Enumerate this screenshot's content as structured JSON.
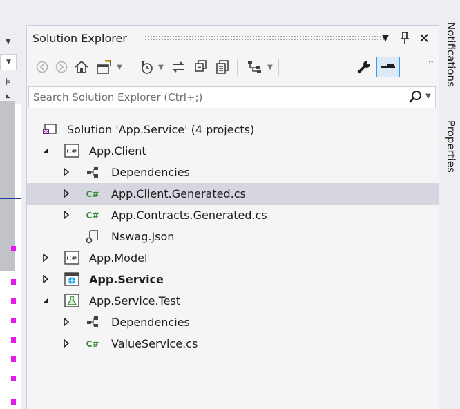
{
  "panel": {
    "title": "Solution Explorer",
    "accent": "#3399ff",
    "selected_row_color": "#d6d6e0"
  },
  "toolbar": {
    "buttons": [
      "back-icon",
      "forward-icon",
      "home-icon",
      "switch-views-icon",
      "pending-changes-filter-icon",
      "sync-with-active-document-icon",
      "collapse-all-icon",
      "show-all-files-icon",
      "preview-selected-items-icon",
      "properties-icon",
      "toggle-preview-icon"
    ]
  },
  "search": {
    "placeholder": "Search Solution Explorer (Ctrl+;)"
  },
  "tree": {
    "solution": "Solution 'App.Service' (4 projects)",
    "client": {
      "label": "App.Client",
      "dependencies": "Dependencies",
      "client_generated": "App.Client.Generated.cs",
      "contracts_generated": "App.Contracts.Generated.cs",
      "nswag": "Nswag.Json"
    },
    "model": {
      "label": "App.Model"
    },
    "service": {
      "label": "App.Service"
    },
    "test": {
      "label": "App.Service.Test",
      "dependencies": "Dependencies",
      "value_service": "ValueService.cs"
    }
  },
  "side_tabs": {
    "notifications": "Notifications",
    "properties": "Properties"
  }
}
